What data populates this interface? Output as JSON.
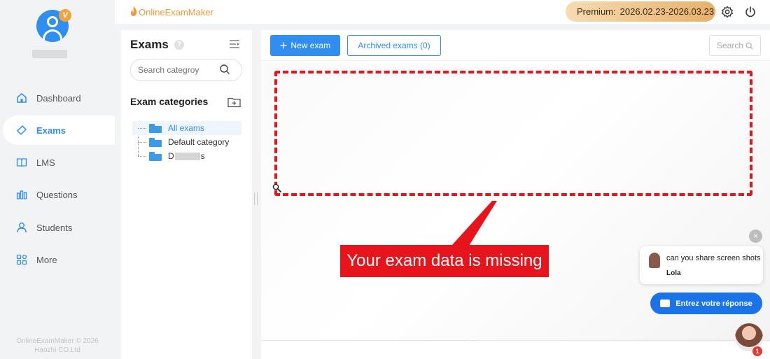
{
  "nav": {
    "items": [
      {
        "label": "Dashboard",
        "icon": "home-icon"
      },
      {
        "label": "Exams",
        "icon": "tag-icon",
        "active": true
      },
      {
        "label": "LMS",
        "icon": "book-icon"
      },
      {
        "label": "Questions",
        "icon": "bars-icon"
      },
      {
        "label": "Students",
        "icon": "user-icon"
      },
      {
        "label": "More",
        "icon": "apps-icon"
      }
    ],
    "copyright_line1": "OnlineExamMaker © 2026",
    "copyright_line2": "Haozhi CO.Ltd",
    "vip_badge": "V"
  },
  "header": {
    "logo_text": "OnlineExamMaker",
    "premium_label": "Premium:",
    "premium_dates": "2026.02.23-2026.03.23"
  },
  "categories_panel": {
    "title": "Exams",
    "help": "?",
    "search_placeholder": "Search categroy",
    "heading": "Exam categories",
    "tree": [
      {
        "label": "All exams",
        "selected": true
      },
      {
        "label": "Default category",
        "selected": false
      },
      {
        "label": "D",
        "suffix": "s",
        "selected": false
      }
    ]
  },
  "toolbar": {
    "new_exam": "New exam",
    "archived_exams": "Archived exams (0)",
    "search": "Search"
  },
  "annotation": {
    "callout": "Your exam data is missing",
    "color": "#e8141b"
  },
  "chat": {
    "close": "×",
    "message": "can you share screen shots",
    "agent": "Lola",
    "reply_button": "Entrez votre réponse",
    "badge": "1"
  },
  "colors": {
    "primary": "#2f8ef0",
    "logo": "#f09a3a",
    "premium_gradient_start": "#f7dcb2",
    "premium_gradient_end": "#e8b06a"
  }
}
